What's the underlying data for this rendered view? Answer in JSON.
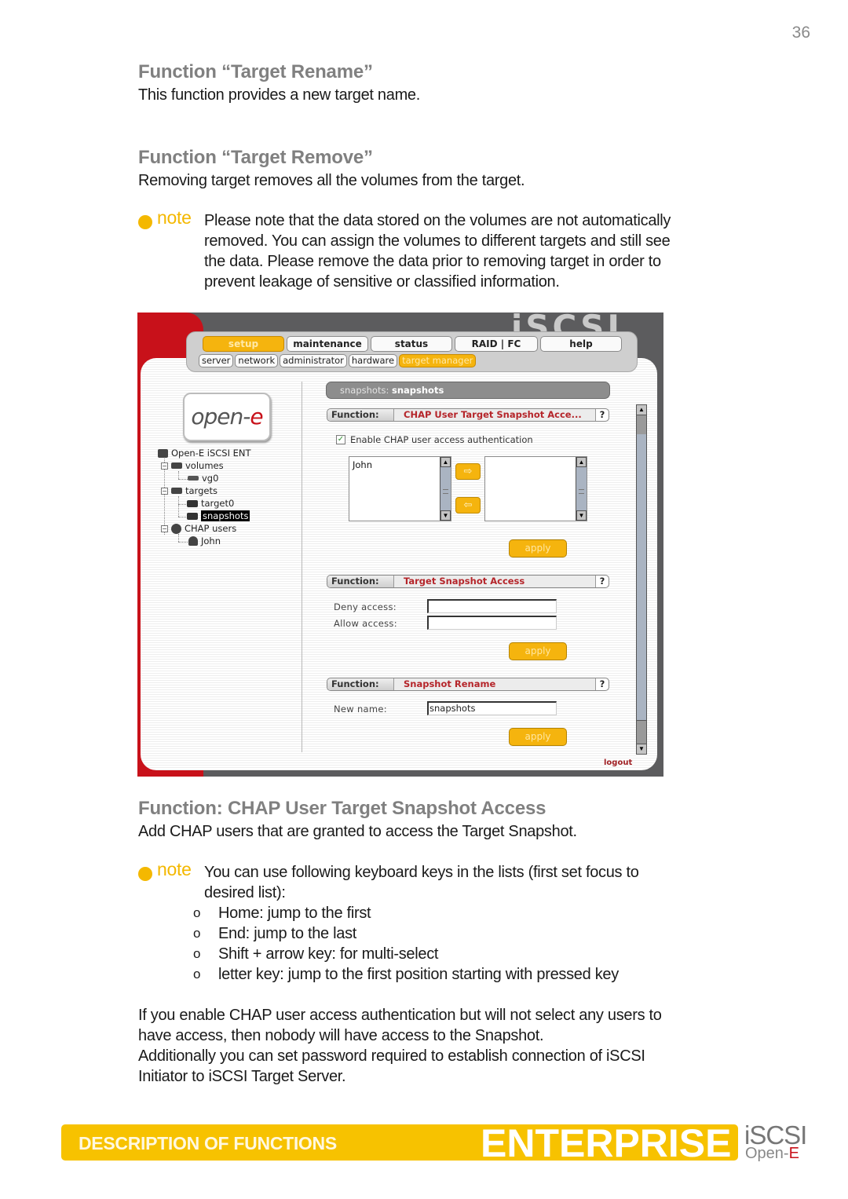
{
  "page_number": "36",
  "sections": {
    "target_rename": {
      "title": "Function “Target Rename”",
      "body": "This function provides a new target name."
    },
    "target_remove": {
      "title": "Function “Target Remove”",
      "body": "Removing target removes all the volumes from the target.",
      "note_label": "note",
      "note_lines": [
        "Please note that the data stored on the volumes are not automatically",
        "removed. You can assign the volumes to different targets and still see",
        "the data. Please remove the data prior to removing target in order to",
        "prevent leakage of sensitive or classified information."
      ]
    },
    "chap_access": {
      "title": "Function: CHAP User Target Snapshot Access",
      "body": "Add CHAP users that are granted to access the Target Snapshot.",
      "note_label": "note",
      "note_lines": [
        "You can use following keyboard keys in the lists (first set focus to",
        "desired list):"
      ],
      "bullet_marker": "o",
      "bullets": [
        "Home: jump to the first",
        "End: jump to the last",
        "Shift + arrow key: for multi-select",
        "letter key: jump to the first position starting with pressed key"
      ],
      "closing_lines": [
        "If you enable CHAP user access authentication but will not select any users to",
        "have access, then nobody will have access to the Snapshot.",
        "Additionally you can set password required to establish connection of iSCSI",
        "Initiator to iSCSI Target Server."
      ]
    }
  },
  "screenshot": {
    "product_logo": "iSCSI",
    "brand_logo": {
      "main": "open-",
      "accent": "e"
    },
    "main_tabs": [
      {
        "label": "setup",
        "active": true
      },
      {
        "label": "maintenance",
        "active": false
      },
      {
        "label": "status",
        "active": false
      },
      {
        "label": "RAID | FC",
        "active": false
      },
      {
        "label": "help",
        "active": false
      }
    ],
    "sub_tabs": [
      {
        "label": "server",
        "active": false
      },
      {
        "label": "network",
        "active": false
      },
      {
        "label": "administrator",
        "active": false
      },
      {
        "label": "hardware",
        "active": false
      },
      {
        "label": "target manager",
        "active": true
      }
    ],
    "tree": {
      "root": "Open-E iSCSI ENT",
      "volumes": "volumes",
      "vg0": "vg0",
      "targets": "targets",
      "target0": "target0",
      "snapshots": "snapshots",
      "chap_users": "CHAP users",
      "john": "John"
    },
    "breadcrumb": {
      "prefix": "snapshots:",
      "current": "snapshots"
    },
    "function_label": "Function:",
    "help_label": "?",
    "chap_panel": {
      "title": "CHAP User Target Snapshot Acce...",
      "checkbox_label": "Enable CHAP user access authentication",
      "checkbox_checked": true,
      "available_users": [
        "John"
      ],
      "granted_users": [],
      "add_arrow": "⇨",
      "remove_arrow": "⇦",
      "apply_label": "apply"
    },
    "access_panel": {
      "title": "Target Snapshot Access",
      "deny_label": "Deny access:",
      "deny_value": "",
      "allow_label": "Allow access:",
      "allow_value": "",
      "apply_label": "apply"
    },
    "rename_panel": {
      "title": "Snapshot Rename",
      "new_name_label": "New name:",
      "new_name_value": "snapshots",
      "apply_label": "apply"
    },
    "logout_label": "logout"
  },
  "footer": {
    "section_label": "DESCRIPTION OF FUNCTIONS",
    "brand": "ENTERPRISE",
    "product": "iSCSI",
    "company_main": "Open-",
    "company_accent": "E"
  }
}
